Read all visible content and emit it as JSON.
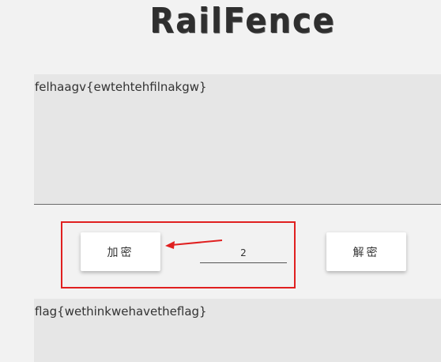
{
  "app": {
    "title": "RailFence"
  },
  "input": {
    "text": "felhaagv{ewtehtehfilnakgw}"
  },
  "controls": {
    "encrypt_label": "加密",
    "decrypt_label": "解密",
    "key_value": "2"
  },
  "output": {
    "text": "flag{wethinkwehavetheflag}"
  },
  "colors": {
    "annotation": "#e02020",
    "background": "#f2f2f2",
    "textarea_bg": "#e6e6e6"
  }
}
